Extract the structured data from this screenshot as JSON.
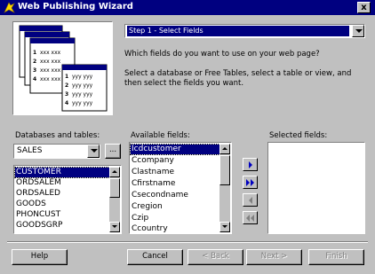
{
  "window": {
    "title": "Web Publishing Wizard",
    "close_label": "x"
  },
  "step": {
    "selected": "Step 1 - Select Fields"
  },
  "instructions": {
    "question": "Which fields do you want to use on your web page?",
    "line1": "Select a database or Free Tables, select a table or view, and",
    "line2": "then select the fields you want."
  },
  "illustration": {
    "rows": [
      {
        "num": "1",
        "text": "xxx  xxx"
      },
      {
        "num": "2",
        "text": "xxx  xxx"
      },
      {
        "num": "3",
        "text": "xxx  xxx"
      },
      {
        "num": "4",
        "text": "xxx  xxx"
      }
    ],
    "front_rows": [
      {
        "num": "1",
        "text": "yyy  yyy"
      },
      {
        "num": "2",
        "text": "yyy  yyy"
      },
      {
        "num": "3",
        "text": "yyy  yyy"
      },
      {
        "num": "4",
        "text": "yyy  yyy"
      }
    ]
  },
  "databases": {
    "label": "Databases and tables:",
    "selected_db": "SALES",
    "browse_label": "...",
    "tables": [
      "CUSTOMER",
      "ORDSALEM",
      "ORDSALED",
      "GOODS",
      "PHONCUST",
      "GOODSGRP"
    ],
    "selected_index": 0
  },
  "available": {
    "label": "Available fields:",
    "fields": [
      "Icdcustomer",
      "Ccompany",
      "Clastname",
      "Cfirstname",
      "Csecondname",
      "Cregion",
      "Czip",
      "Ccountry"
    ],
    "selected_index": 0
  },
  "selected_fields": {
    "label": "Selected fields:",
    "items": []
  },
  "buttons": {
    "help": "Help",
    "cancel": "Cancel",
    "back": "< Back",
    "next": "Next >",
    "finish": "Finish"
  },
  "colors": {
    "selection": "#000080",
    "face": "#c0c0c0",
    "move_arrow": "#0000c0"
  }
}
